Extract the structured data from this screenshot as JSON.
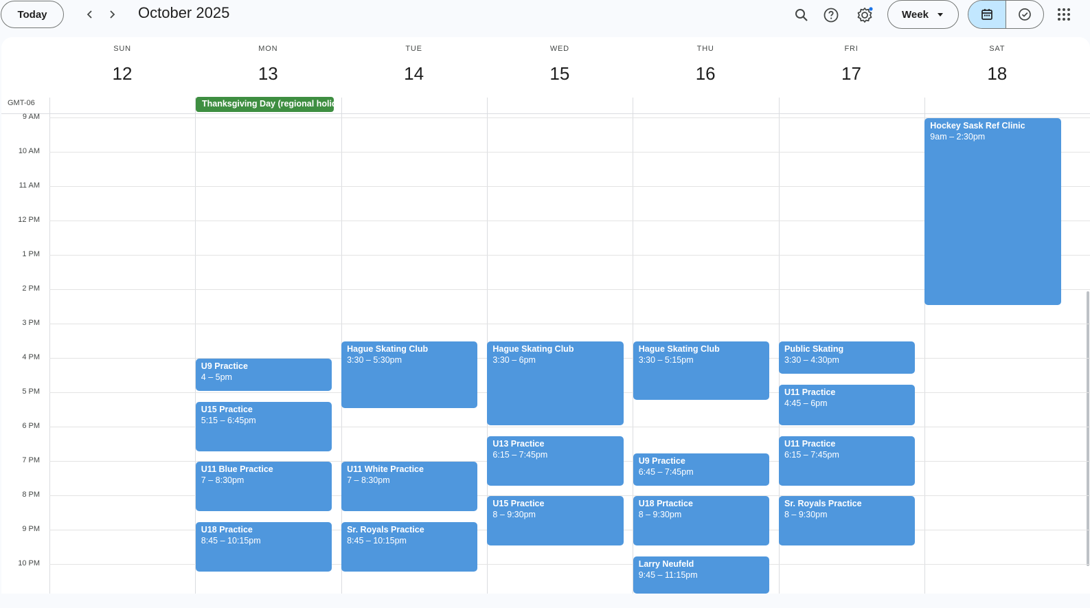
{
  "toolbar": {
    "today_label": "Today",
    "prev_label": "‹",
    "next_label": "›",
    "month_title": "October 2025",
    "view_label": "Week"
  },
  "icons": {
    "search": "search-icon",
    "help": "help-icon",
    "settings": "settings-icon",
    "calendar_view": "calendar-icon",
    "tasks_view": "tasks-icon",
    "apps": "apps-grid-icon"
  },
  "colors": {
    "event": "#4f97dd",
    "holiday": "#3e8e41",
    "active_toggle": "#c2e7ff"
  },
  "timezone_label": "GMT-06",
  "days": [
    {
      "name": "SUN",
      "num": "12"
    },
    {
      "name": "MON",
      "num": "13"
    },
    {
      "name": "TUE",
      "num": "14"
    },
    {
      "name": "WED",
      "num": "15"
    },
    {
      "name": "THU",
      "num": "16"
    },
    {
      "name": "FRI",
      "num": "17"
    },
    {
      "name": "SAT",
      "num": "18"
    }
  ],
  "hours": [
    "9 AM",
    "10 AM",
    "11 AM",
    "12 PM",
    "1 PM",
    "2 PM",
    "3 PM",
    "4 PM",
    "5 PM",
    "6 PM",
    "7 PM",
    "8 PM",
    "9 PM",
    "10 PM"
  ],
  "all_day": {
    "holiday_label": "Thanksgiving Day (regional holiday)"
  },
  "events": [
    {
      "day": 1,
      "title": "U9 Practice",
      "time": "4 – 5pm",
      "start": 16.0,
      "end": 17.0
    },
    {
      "day": 1,
      "title": "U15 Practice",
      "time": "5:15 – 6:45pm",
      "start": 17.25,
      "end": 18.75
    },
    {
      "day": 1,
      "title": "U11 Blue Practice",
      "time": "7 – 8:30pm",
      "start": 19.0,
      "end": 20.5
    },
    {
      "day": 1,
      "title": "U18 Practice",
      "time": "8:45 – 10:15pm",
      "start": 20.75,
      "end": 22.25
    },
    {
      "day": 2,
      "title": "Hague Skating Club",
      "time": "3:30 – 5:30pm",
      "start": 15.5,
      "end": 17.5
    },
    {
      "day": 2,
      "title": "U11 White Practice",
      "time": "7 – 8:30pm",
      "start": 19.0,
      "end": 20.5
    },
    {
      "day": 2,
      "title": "Sr. Royals Practice",
      "time": "8:45 – 10:15pm",
      "start": 20.75,
      "end": 22.25
    },
    {
      "day": 3,
      "title": "Hague Skating Club",
      "time": "3:30 – 6pm",
      "start": 15.5,
      "end": 18.0
    },
    {
      "day": 3,
      "title": "U13 Practice",
      "time": "6:15 – 7:45pm",
      "start": 18.25,
      "end": 19.75
    },
    {
      "day": 3,
      "title": "U15 Practice",
      "time": "8 – 9:30pm",
      "start": 20.0,
      "end": 21.5
    },
    {
      "day": 4,
      "title": "Hague Skating Club",
      "time": "3:30 – 5:15pm",
      "start": 15.5,
      "end": 17.25
    },
    {
      "day": 4,
      "title": "U9 Practice",
      "time": "6:45 – 7:45pm",
      "start": 18.75,
      "end": 19.75
    },
    {
      "day": 4,
      "title": "U18 Prtactice",
      "time": "8 – 9:30pm",
      "start": 20.0,
      "end": 21.5
    },
    {
      "day": 4,
      "title": "Larry Neufeld",
      "time": "9:45 – 11:15pm",
      "start": 21.75,
      "end": 23.25
    },
    {
      "day": 5,
      "title": "Public Skating",
      "time": "3:30 – 4:30pm",
      "start": 15.5,
      "end": 16.5
    },
    {
      "day": 5,
      "title": "U11 Practice",
      "time": "4:45 – 6pm",
      "start": 16.75,
      "end": 18.0
    },
    {
      "day": 5,
      "title": "U11 Practice",
      "time": "6:15 – 7:45pm",
      "start": 18.25,
      "end": 19.75
    },
    {
      "day": 5,
      "title": "Sr. Royals Practice",
      "time": "8 – 9:30pm",
      "start": 20.0,
      "end": 21.5
    },
    {
      "day": 6,
      "title": "Hockey Sask Ref Clinic",
      "time": "9am – 2:30pm",
      "start": 9.0,
      "end": 14.5
    }
  ]
}
